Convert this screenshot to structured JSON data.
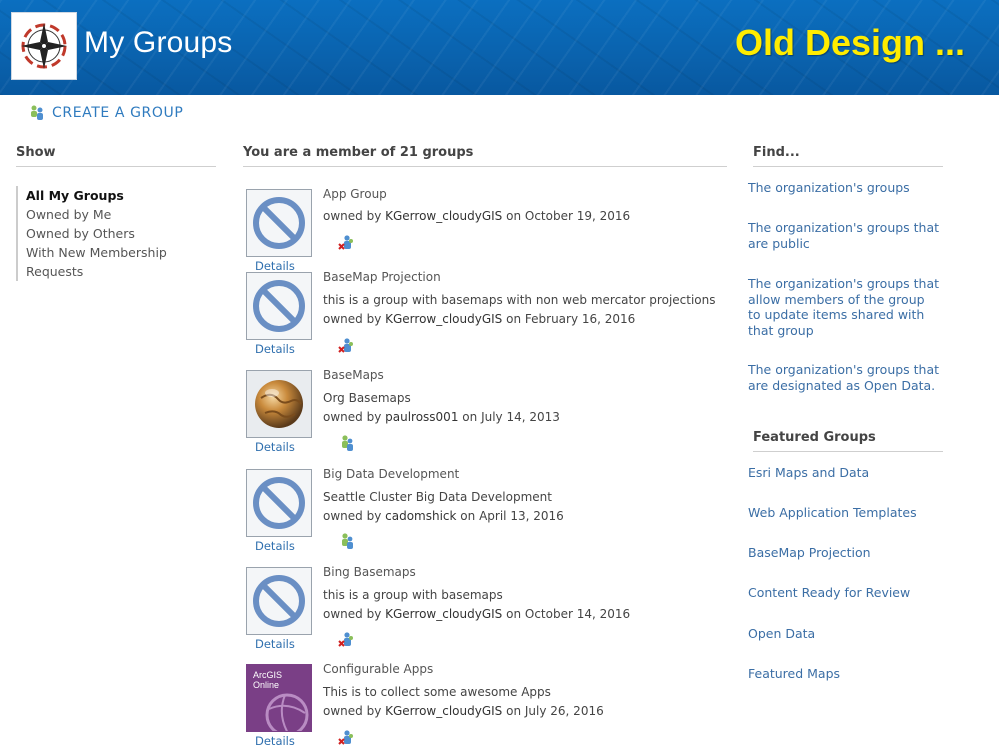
{
  "header": {
    "title": "My Groups",
    "badge": "Old Design ...",
    "logo_icon": "compass-rose-icon"
  },
  "create_group": {
    "label": "CREATE A GROUP",
    "icon": "group-people-icon"
  },
  "show": {
    "heading": "Show",
    "items": [
      {
        "label": "All My Groups",
        "active": true
      },
      {
        "label": "Owned by Me",
        "active": false
      },
      {
        "label": "Owned by Others",
        "active": false
      },
      {
        "label": "With New Membership Requests",
        "active": false
      }
    ]
  },
  "groups_section": {
    "heading": "You are a member of 21 groups",
    "details_label": "Details",
    "owned_by_prefix": "owned by",
    "on_word": "on",
    "groups": [
      {
        "name": "App Group",
        "description": "",
        "owner": "KGerrow_cloudyGIS",
        "date": "October 19, 2016",
        "thumbnail": "no-thumbnail-icon",
        "action_icon": "leave-group-icon"
      },
      {
        "name": "BaseMap Projection",
        "description": "this is a group with basemaps with non web mercator projections",
        "owner": "KGerrow_cloudyGIS",
        "date": "February 16, 2016",
        "thumbnail": "no-thumbnail-icon",
        "action_icon": "leave-group-icon"
      },
      {
        "name": "BaseMaps",
        "description": "Org Basemaps",
        "owner": "paulross001",
        "date": "July 14, 2013",
        "thumbnail": "globe-icon",
        "action_icon": "members-icon"
      },
      {
        "name": "Big Data Development",
        "description": "Seattle Cluster Big Data Development",
        "owner": "cadomshick",
        "date": "April 13, 2016",
        "thumbnail": "no-thumbnail-icon",
        "action_icon": "members-icon"
      },
      {
        "name": "Bing Basemaps",
        "description": "this is a group with basemaps",
        "owner": "KGerrow_cloudyGIS",
        "date": "October 14, 2016",
        "thumbnail": "no-thumbnail-icon",
        "action_icon": "leave-group-icon"
      },
      {
        "name": "Configurable Apps",
        "description": "This is to collect some awesome Apps",
        "owner": "KGerrow_cloudyGIS",
        "date": "July 26, 2016",
        "thumbnail": "arcgis-online-icon",
        "thumbnail_text": [
          "ArcGIS",
          "Online"
        ],
        "action_icon": "leave-group-icon"
      }
    ]
  },
  "find": {
    "heading": "Find...",
    "links": [
      "The organization's groups",
      "The organization's groups that are public",
      "The organization's groups that allow members of the group to update items shared with that group",
      "The organization's groups that are designated as Open Data."
    ]
  },
  "featured": {
    "heading": "Featured Groups",
    "links": [
      "Esri Maps and Data",
      "Web Application Templates",
      "BaseMap Projection",
      "Content Ready for Review",
      "Open Data",
      "Featured Maps"
    ]
  },
  "colors": {
    "header_blue": "#0a62ad",
    "badge_yellow": "#ffec00",
    "link_blue": "#3b6ea5",
    "no_thumb_blue": "#6a8fc4",
    "arcgis_purple": "#7a3f86"
  }
}
